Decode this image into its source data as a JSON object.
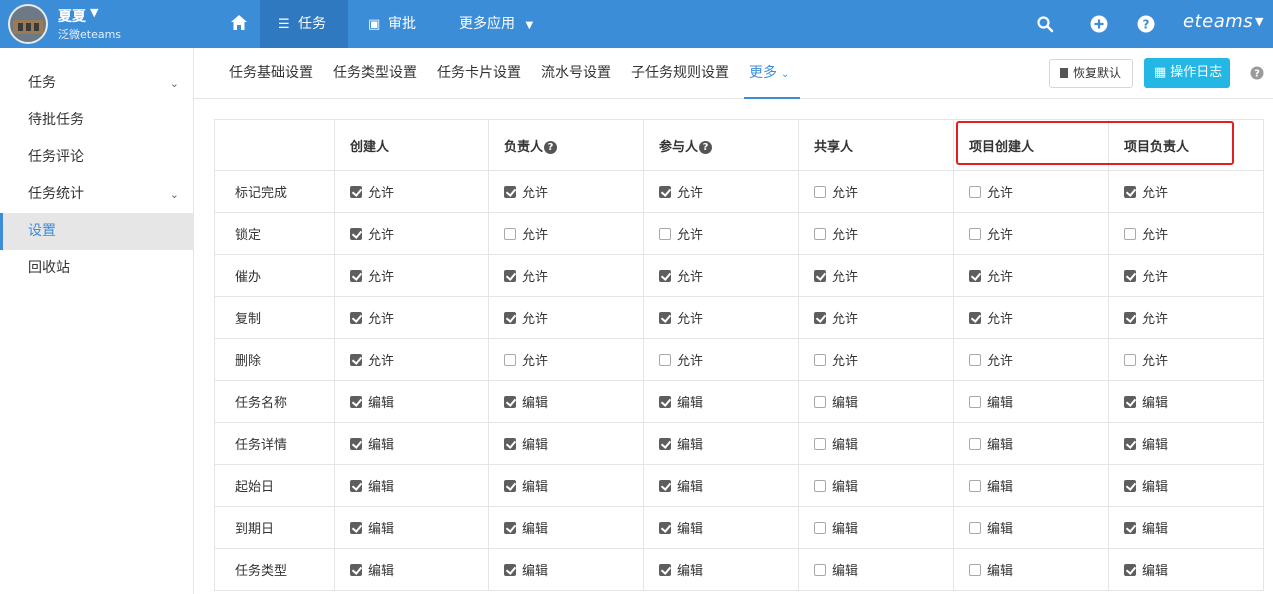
{
  "user": {
    "name": "夏夏",
    "company": "泛微eteams"
  },
  "topnav": {
    "tabs": [
      {
        "label": "任务",
        "icon": "list-icon"
      },
      {
        "label": "审批",
        "icon": "approve-icon"
      },
      {
        "label": "更多应用",
        "icon": "chevron-down-icon"
      }
    ],
    "brand": "eteams"
  },
  "sidebar": {
    "items": [
      {
        "label": "任务"
      },
      {
        "label": "待批任务"
      },
      {
        "label": "任务评论"
      },
      {
        "label": "任务统计"
      },
      {
        "label": "设置"
      },
      {
        "label": "回收站"
      }
    ]
  },
  "subnav": {
    "tabs": [
      {
        "label": "任务基础设置"
      },
      {
        "label": "任务类型设置"
      },
      {
        "label": "任务卡片设置"
      },
      {
        "label": "流水号设置"
      },
      {
        "label": "子任务规则设置"
      },
      {
        "label": "更多"
      }
    ],
    "reset_label": "恢复默认",
    "log_label": "操作日志"
  },
  "table": {
    "columns": [
      {
        "label": ""
      },
      {
        "label": "创建人"
      },
      {
        "label": "负责人"
      },
      {
        "label": "参与人"
      },
      {
        "label": "共享人"
      },
      {
        "label": "项目创建人"
      },
      {
        "label": "项目负责人"
      }
    ],
    "rows": [
      {
        "label": "标记完成",
        "action": "允许",
        "checks": [
          true,
          true,
          true,
          false,
          false,
          true
        ]
      },
      {
        "label": "锁定",
        "action": "允许",
        "checks": [
          true,
          false,
          false,
          false,
          false,
          false
        ]
      },
      {
        "label": "催办",
        "action": "允许",
        "checks": [
          true,
          true,
          true,
          true,
          true,
          true
        ]
      },
      {
        "label": "复制",
        "action": "允许",
        "checks": [
          true,
          true,
          true,
          true,
          true,
          true
        ]
      },
      {
        "label": "删除",
        "action": "允许",
        "checks": [
          true,
          false,
          false,
          false,
          false,
          false
        ]
      },
      {
        "label": "任务名称",
        "action": "编辑",
        "checks": [
          true,
          true,
          true,
          false,
          false,
          true
        ]
      },
      {
        "label": "任务详情",
        "action": "编辑",
        "checks": [
          true,
          true,
          true,
          false,
          false,
          true
        ]
      },
      {
        "label": "起始日",
        "action": "编辑",
        "checks": [
          true,
          true,
          true,
          false,
          false,
          true
        ]
      },
      {
        "label": "到期日",
        "action": "编辑",
        "checks": [
          true,
          true,
          true,
          false,
          false,
          true
        ]
      },
      {
        "label": "任务类型",
        "action": "编辑",
        "checks": [
          true,
          true,
          true,
          false,
          false,
          true
        ]
      }
    ]
  },
  "colors": {
    "topbar": "#3c8dd8",
    "accent": "#3c8dd8",
    "log_button": "#23b7e5",
    "highlight": "#e02020"
  }
}
